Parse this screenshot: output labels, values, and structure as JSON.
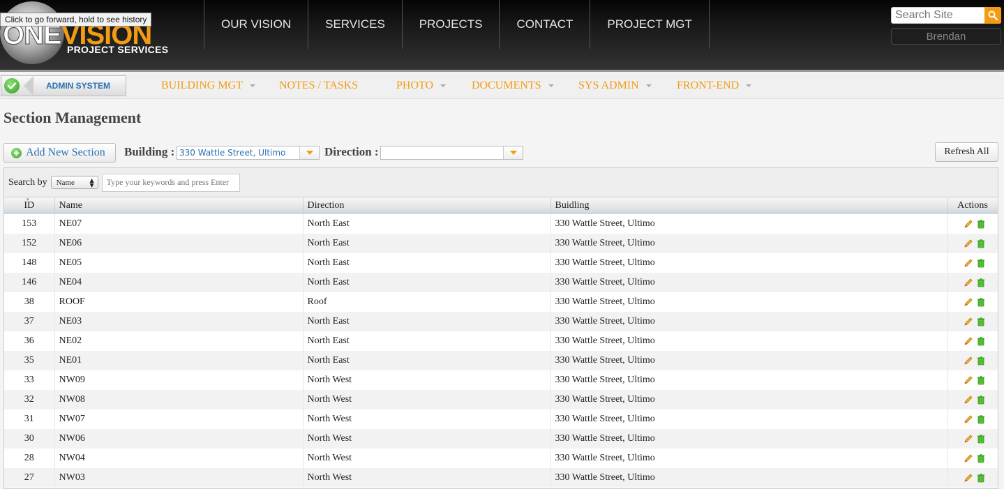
{
  "browser": {
    "tooltip": "Click to go forward, hold to see history"
  },
  "header": {
    "logo_one": "ONE",
    "logo_vision": "VISION",
    "logo_sub": "PROJECT SERVICES",
    "nav": [
      "OUR VISION",
      "SERVICES",
      "PROJECTS",
      "CONTACT",
      "PROJECT MGT"
    ],
    "search_placeholder": "Search Site",
    "user": "Brendan"
  },
  "subnav": {
    "admin_label": "ADMIN SYSTEM",
    "items": [
      {
        "label": "BUILDING MGT",
        "has_dropdown": true
      },
      {
        "label": "NOTES / TASKS",
        "has_dropdown": false
      },
      {
        "label": "PHOTO",
        "has_dropdown": true
      },
      {
        "label": "DOCUMENTS",
        "has_dropdown": true
      },
      {
        "label": "SYS ADMIN",
        "has_dropdown": true
      },
      {
        "label": "FRONT-END",
        "has_dropdown": true
      }
    ]
  },
  "page": {
    "title": "Section Management",
    "add_button": "Add New Section",
    "building_label": "Building :",
    "building_value": "330 Wattle Street, Ultimo",
    "direction_label": "Direction :",
    "direction_value": "",
    "refresh_button": "Refresh All"
  },
  "grid": {
    "search_label": "Search by",
    "search_field": "Name",
    "search_placeholder": "Type your keywords and press Enter",
    "columns": [
      "ID",
      "Name",
      "Direction",
      "Buidling",
      "Actions"
    ],
    "rows": [
      {
        "id": "153",
        "name": "NE07",
        "direction": "North East",
        "building": "330 Wattle Street, Ultimo"
      },
      {
        "id": "152",
        "name": "NE06",
        "direction": "North East",
        "building": "330 Wattle Street, Ultimo"
      },
      {
        "id": "148",
        "name": "NE05",
        "direction": "North East",
        "building": "330 Wattle Street, Ultimo"
      },
      {
        "id": "146",
        "name": "NE04",
        "direction": "North East",
        "building": "330 Wattle Street, Ultimo"
      },
      {
        "id": "38",
        "name": "ROOF",
        "direction": "Roof",
        "building": "330 Wattle Street, Ultimo"
      },
      {
        "id": "37",
        "name": "NE03",
        "direction": "North East",
        "building": "330 Wattle Street, Ultimo"
      },
      {
        "id": "36",
        "name": "NE02",
        "direction": "North East",
        "building": "330 Wattle Street, Ultimo"
      },
      {
        "id": "35",
        "name": "NE01",
        "direction": "North East",
        "building": "330 Wattle Street, Ultimo"
      },
      {
        "id": "33",
        "name": "NW09",
        "direction": "North West",
        "building": "330 Wattle Street, Ultimo"
      },
      {
        "id": "32",
        "name": "NW08",
        "direction": "North West",
        "building": "330 Wattle Street, Ultimo"
      },
      {
        "id": "31",
        "name": "NW07",
        "direction": "North West",
        "building": "330 Wattle Street, Ultimo"
      },
      {
        "id": "30",
        "name": "NW06",
        "direction": "North West",
        "building": "330 Wattle Street, Ultimo"
      },
      {
        "id": "28",
        "name": "NW04",
        "direction": "North West",
        "building": "330 Wattle Street, Ultimo"
      },
      {
        "id": "27",
        "name": "NW03",
        "direction": "North West",
        "building": "330 Wattle Street, Ultimo"
      }
    ]
  },
  "colors": {
    "accent": "#f39c12",
    "link": "#2a6fb4",
    "header_bg": "#111111"
  },
  "icons": {
    "search": "magnifier-icon",
    "check": "check-icon",
    "add": "plus-circle-icon",
    "edit": "pencil-icon",
    "delete": "trash-icon"
  }
}
